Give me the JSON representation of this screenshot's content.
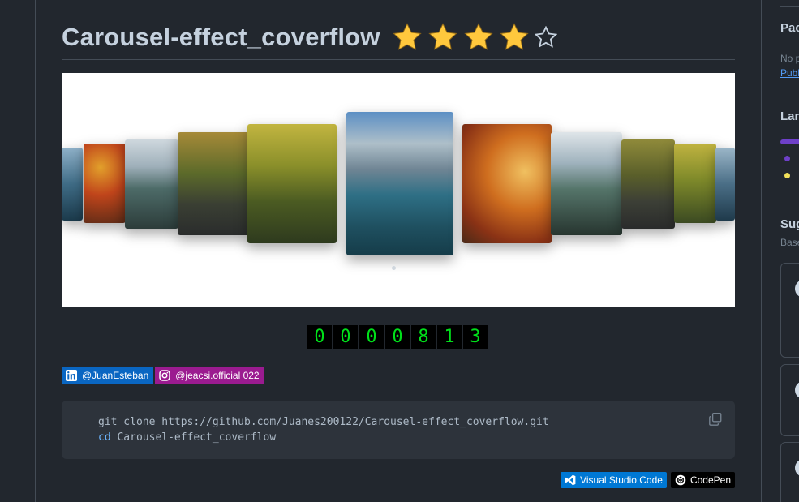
{
  "readme": {
    "title": "Carousel-effect_coverflow",
    "rating": {
      "filled": 4,
      "total": 5
    }
  },
  "carousel": {
    "slides": 11,
    "active_index": 0
  },
  "visitor_counter": {
    "digits": [
      "0",
      "0",
      "0",
      "0",
      "8",
      "1",
      "3"
    ]
  },
  "social_badges": {
    "linkedin": "@JuanEsteban",
    "instagram": "@jeacsi.official 022"
  },
  "code": {
    "line1": "git clone https://github.com/Juanes200122/Carousel-effect_coverflow.git",
    "line2_keyword": "cd",
    "line2_rest": " Carousel-effect_coverflow"
  },
  "tool_badges": {
    "vscode": "Visual Studio Code",
    "codepen": "CodePen"
  },
  "sidebar": {
    "packages_heading": "Pac",
    "packages_text": "No p",
    "packages_link": "Publ",
    "languages_heading": "Lan",
    "suggested_heading": "Sug",
    "suggested_sub": "Base",
    "colors": {
      "lang1": "#6e40c9",
      "lang2": "#f1e05a"
    }
  },
  "colors": {
    "background": "#22272e",
    "star": "#ffc83d",
    "counter_digit": "#00e01a",
    "linkedin": "#0a66c2",
    "instagram": "#9b1b90",
    "vscode": "#0078d4"
  }
}
